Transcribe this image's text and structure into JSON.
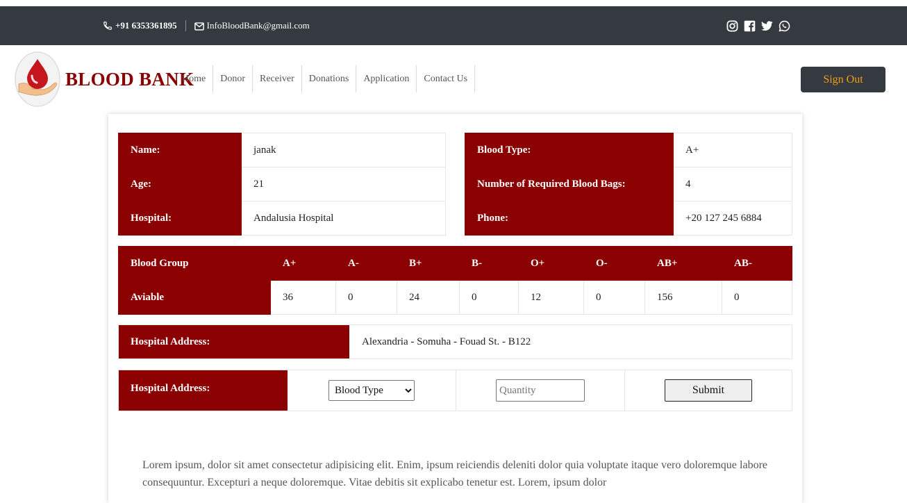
{
  "topbar": {
    "phone": "+91 6353361895",
    "email": "InfoBloodBank@gmail.com",
    "social_icons": [
      "instagram-icon",
      "facebook-icon",
      "twitter-icon",
      "whatsapp-icon"
    ]
  },
  "navbar": {
    "brand": "BLOOD BANK",
    "links": [
      "Home",
      "Donor",
      "Receiver",
      "Donations",
      "Application",
      "Contact Us"
    ],
    "sign_out": "Sign Out"
  },
  "receiver": {
    "name_label": "Name:",
    "name": "janak",
    "age_label": "Age:",
    "age": "21",
    "hospital_label": "Hospital:",
    "hospital": "Andalusia Hospital",
    "blood_type_label": "Blood Type:",
    "blood_type": "A+",
    "bags_label": "Number of Required Blood Bags:",
    "bags": "4",
    "phone_label": "Phone:",
    "phone": "+20 127 245 6884"
  },
  "availability": {
    "header_label": "Blood Group",
    "row_label": "Aviable",
    "groups": [
      "A+",
      "A-",
      "B+",
      "B-",
      "O+",
      "O-",
      "AB+",
      "AB-"
    ],
    "counts": [
      "36",
      "0",
      "24",
      "0",
      "12",
      "0",
      "156",
      "0"
    ]
  },
  "address": {
    "label": "Hospital Address:",
    "value": "Alexandria - Somuha - Fouad St. - B122"
  },
  "request": {
    "label": "Hospital Address:",
    "select_value": "Blood Type",
    "quantity_placeholder": "Quantity",
    "submit": "Submit"
  },
  "lorem": "Lorem ipsum, dolor sit amet consectetur adipisicing elit. Enim, ipsum reiciendis deleniti dolor quia voluptate itaque vero doloremque labore consequuntur. Excepturi a neque doloremque. Vitae debitis sit explicabo tenetur est. Lorem, ipsum dolor",
  "colors": {
    "accent": "#8b0000",
    "dark": "#343a40",
    "signout_text": "#f39c12"
  }
}
